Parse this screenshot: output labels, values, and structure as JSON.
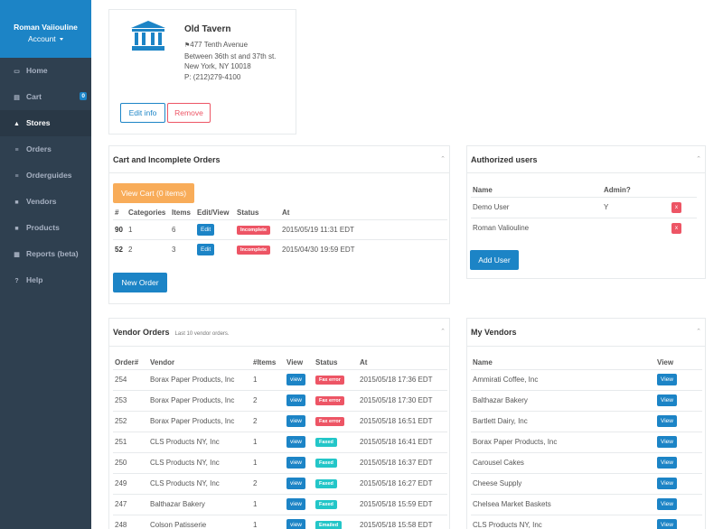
{
  "sidebar": {
    "user_name": "Roman Vaiiouline",
    "account_label": "Account",
    "nav": [
      {
        "label": "Home",
        "icon": "desktop-icon"
      },
      {
        "label": "Cart",
        "icon": "cart-icon",
        "badge": "0"
      },
      {
        "label": "Stores",
        "icon": "bank-icon"
      },
      {
        "label": "Orders",
        "icon": "list-icon"
      },
      {
        "label": "Orderguides",
        "icon": "list-icon"
      },
      {
        "label": "Vendors",
        "icon": "truck-icon"
      },
      {
        "label": "Products",
        "icon": "truck-icon"
      },
      {
        "label": "Reports (beta)",
        "icon": "report-icon"
      },
      {
        "label": "Help",
        "icon": "help-icon"
      }
    ],
    "active": "Stores"
  },
  "store": {
    "name": "Old Tavern",
    "address": [
      "477 Tenth Avenue",
      "Between 36th st and 37th st.",
      "New York, NY 10018",
      "P: (212)279-4100"
    ],
    "edit_label": "Edit info",
    "remove_label": "Remove"
  },
  "cart_orders": {
    "title": "Cart and Incomplete Orders",
    "view_cart_label": "View Cart (0 items)",
    "headers": [
      "#",
      "Categories",
      "Items",
      "Edit/View",
      "Status",
      "At"
    ],
    "rows": [
      {
        "num": "90",
        "categories": "1",
        "items": "6",
        "action": "Edit",
        "status": "Incomplete",
        "at": "2015/05/19 11:31 EDT"
      },
      {
        "num": "52",
        "categories": "2",
        "items": "3",
        "action": "Edit",
        "status": "Incomplete",
        "at": "2015/04/30 19:59 EDT"
      }
    ],
    "new_order_label": "New Order"
  },
  "authorized_users": {
    "title": "Authorized users",
    "headers": [
      "Name",
      "Admin?"
    ],
    "rows": [
      {
        "name": "Demo User",
        "admin": "Y",
        "remove": "x"
      },
      {
        "name": "Roman Valiouline",
        "admin": "",
        "remove": "x"
      }
    ],
    "add_user_label": "Add User"
  },
  "vendor_orders": {
    "title": "Vendor Orders",
    "subtitle": "Last 10 vendor orders.",
    "headers": [
      "Order#",
      "Vendor",
      "#Items",
      "View",
      "Status",
      "At"
    ],
    "rows": [
      {
        "order": "254",
        "vendor": "Borax Paper Products, Inc",
        "items": "1",
        "view": "view",
        "status": "Fax error",
        "status_type": "error",
        "at": "2015/05/18 17:36 EDT"
      },
      {
        "order": "253",
        "vendor": "Borax Paper Products, Inc",
        "items": "2",
        "view": "view",
        "status": "Fax error",
        "status_type": "error",
        "at": "2015/05/18 17:30 EDT"
      },
      {
        "order": "252",
        "vendor": "Borax Paper Products, Inc",
        "items": "2",
        "view": "view",
        "status": "Fax error",
        "status_type": "error",
        "at": "2015/05/18 16:51 EDT"
      },
      {
        "order": "251",
        "vendor": "CLS Products NY, Inc",
        "items": "1",
        "view": "view",
        "status": "Faxed",
        "status_type": "ok",
        "at": "2015/05/18 16:41 EDT"
      },
      {
        "order": "250",
        "vendor": "CLS Products NY, Inc",
        "items": "1",
        "view": "view",
        "status": "Faxed",
        "status_type": "ok",
        "at": "2015/05/18 16:37 EDT"
      },
      {
        "order": "249",
        "vendor": "CLS Products NY, Inc",
        "items": "2",
        "view": "view",
        "status": "Faxed",
        "status_type": "ok",
        "at": "2015/05/18 16:27 EDT"
      },
      {
        "order": "247",
        "vendor": "Balthazar Bakery",
        "items": "1",
        "view": "view",
        "status": "Faxed",
        "status_type": "ok",
        "at": "2015/05/18 15:59 EDT"
      },
      {
        "order": "248",
        "vendor": "Colson Patisserie",
        "items": "1",
        "view": "view",
        "status": "Emailed",
        "status_type": "ok",
        "at": "2015/05/18 15:58 EDT"
      }
    ]
  },
  "my_vendors": {
    "title": "My Vendors",
    "headers": [
      "Name",
      "View"
    ],
    "rows": [
      {
        "name": "Ammirati Coffee, Inc",
        "view": "View"
      },
      {
        "name": "Balthazar Bakery",
        "view": "View"
      },
      {
        "name": "Bartlett Dairy, Inc",
        "view": "View"
      },
      {
        "name": "Borax Paper Products, Inc",
        "view": "View"
      },
      {
        "name": "Carousel Cakes",
        "view": "View"
      },
      {
        "name": "Cheese Supply",
        "view": "View"
      },
      {
        "name": "Chelsea Market Baskets",
        "view": "View"
      },
      {
        "name": "CLS Products NY, Inc",
        "view": "View"
      }
    ]
  },
  "colors": {
    "sidebar_bg": "#2f4050",
    "primary": "#1c84c6",
    "danger": "#ed5565",
    "warning": "#f8ac59",
    "success": "#23c6c8"
  }
}
